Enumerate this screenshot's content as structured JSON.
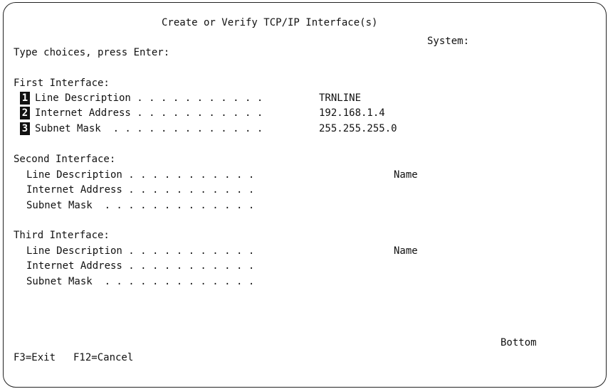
{
  "header": {
    "title": "Create or Verify TCP/IP Interface(s)",
    "system_label": "System:"
  },
  "instructions": "Type choices, press Enter:",
  "first_interface": {
    "heading": "First Interface:",
    "rows": [
      {
        "marker": "1",
        "label": "Line Description . . . . . . . . . . .",
        "value": "TRNLINE"
      },
      {
        "marker": "2",
        "label": "Internet Address . . . . . . . . . . .",
        "value": "192.168.1.4"
      },
      {
        "marker": "3",
        "label": "Subnet Mask  . . . . . . . . . . . . .",
        "value": "255.255.255.0"
      }
    ]
  },
  "second_interface": {
    "heading": "Second Interface:",
    "rows": [
      {
        "label": "Line Description . . . . . . . . . . .",
        "value": "",
        "hint": "Name"
      },
      {
        "label": "Internet Address . . . . . . . . . . .",
        "value": ""
      },
      {
        "label": "Subnet Mask  . . . . . . . . . . . . .",
        "value": ""
      }
    ]
  },
  "third_interface": {
    "heading": "Third Interface:",
    "rows": [
      {
        "label": "Line Description . . . . . . . . . . .",
        "value": "",
        "hint": "Name"
      },
      {
        "label": "Internet Address . . . . . . . . . . .",
        "value": ""
      },
      {
        "label": "Subnet Mask  . . . . . . . . . . . . .",
        "value": ""
      }
    ]
  },
  "scroll_indicator": "Bottom",
  "function_keys": [
    {
      "label": "F3=Exit"
    },
    {
      "label": "F12=Cancel"
    }
  ]
}
